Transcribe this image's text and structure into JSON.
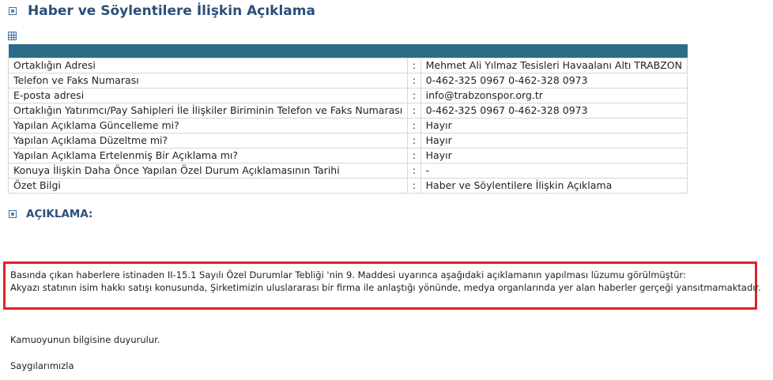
{
  "page": {
    "title": "Haber ve Söylentilere İlişkin Açıklama"
  },
  "info_table": {
    "separator": ":",
    "rows": [
      {
        "label": "Ortaklığın Adresi",
        "value": "Mehmet Ali Yılmaz Tesisleri Havaalanı Altı TRABZON"
      },
      {
        "label": "Telefon ve Faks Numarası",
        "value": "0-462-325 0967 0-462-328 0973"
      },
      {
        "label": "E-posta adresi",
        "value": "info@trabzonspor.org.tr"
      },
      {
        "label": "Ortaklığın Yatırımcı/Pay Sahipleri İle İlişkiler Biriminin Telefon ve Faks Numarası",
        "value": "0-462-325 0967 0-462-328 0973"
      },
      {
        "label": "Yapılan Açıklama Güncelleme mi?",
        "value": "Hayır"
      },
      {
        "label": "Yapılan Açıklama Düzeltme mi?",
        "value": "Hayır"
      },
      {
        "label": "Yapılan Açıklama Ertelenmiş Bir Açıklama mı?",
        "value": "Hayır"
      },
      {
        "label": "Konuya İlişkin Daha Önce Yapılan Özel Durum Açıklamasının Tarihi",
        "value": "-"
      },
      {
        "label": "Özet Bilgi",
        "value": "Haber ve Söylentilere İlişkin Açıklama"
      }
    ]
  },
  "section": {
    "title": "AÇIKLAMA:"
  },
  "statement": {
    "line1": "Basında çıkan haberlere istinaden  II-15.1 Sayılı Özel Durumlar Tebliği 'nin 9. Maddesi uyarınca aşağıdaki açıklamanın yapılması  lüzumu görülmüştür:",
    "line2": "Akyazı statının isim hakkı satışı konusunda, Şirketimizin uluslararası bir firma ile anlaştığı yönünde, medya organlarında yer alan haberler gerçeği yansıtmamaktadır."
  },
  "footer": {
    "notice": "Kamuoyunun bilgisine duyurulur.",
    "closing": "Saygılarımızla"
  },
  "colors": {
    "title_blue": "#2b4f7a",
    "table_header": "#2e6b87",
    "highlight_red": "#e0202a"
  }
}
